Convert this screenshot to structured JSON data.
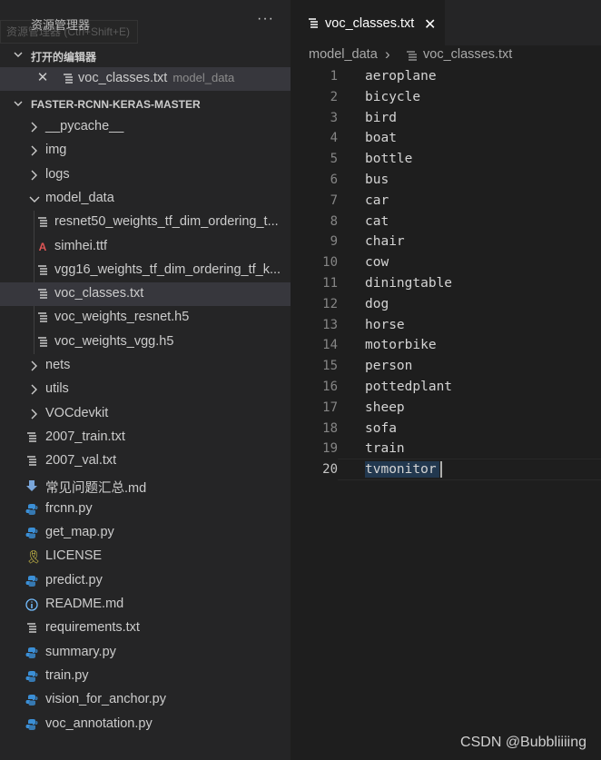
{
  "explorer": {
    "title": "资源管理器",
    "more": "···",
    "tooltip": "资源管理器 (Ctrl+Shift+E)"
  },
  "open_editors": {
    "header": "打开的编辑器",
    "items": [
      {
        "name": "voc_classes.txt",
        "folder": "model_data",
        "close": "✕"
      }
    ]
  },
  "project": {
    "header": "FASTER-RCNN-KERAS-MASTER",
    "tree": [
      {
        "label": "__pycache__",
        "type": "folder"
      },
      {
        "label": "img",
        "type": "folder"
      },
      {
        "label": "logs",
        "type": "folder"
      },
      {
        "label": "model_data",
        "type": "folder-open"
      },
      {
        "label": "resnet50_weights_tf_dim_ordering_t...",
        "type": "file-lines"
      },
      {
        "label": "simhei.ttf",
        "type": "font"
      },
      {
        "label": "vgg16_weights_tf_dim_ordering_tf_k...",
        "type": "file-lines"
      },
      {
        "label": "voc_classes.txt",
        "type": "file-lines"
      },
      {
        "label": "voc_weights_resnet.h5",
        "type": "file-lines"
      },
      {
        "label": "voc_weights_vgg.h5",
        "type": "file-lines"
      },
      {
        "label": "nets",
        "type": "folder"
      },
      {
        "label": "utils",
        "type": "folder"
      },
      {
        "label": "VOCdevkit",
        "type": "folder"
      },
      {
        "label": "2007_train.txt",
        "type": "file-lines"
      },
      {
        "label": "2007_val.txt",
        "type": "file-lines"
      },
      {
        "label": "常见问题汇总.md",
        "type": "download"
      },
      {
        "label": "frcnn.py",
        "type": "python"
      },
      {
        "label": "get_map.py",
        "type": "python"
      },
      {
        "label": "LICENSE",
        "type": "license"
      },
      {
        "label": "predict.py",
        "type": "python"
      },
      {
        "label": "README.md",
        "type": "info"
      },
      {
        "label": "requirements.txt",
        "type": "file-lines"
      },
      {
        "label": "summary.py",
        "type": "python"
      },
      {
        "label": "train.py",
        "type": "python"
      },
      {
        "label": "vision_for_anchor.py",
        "type": "python"
      },
      {
        "label": "voc_annotation.py",
        "type": "python"
      }
    ]
  },
  "editor": {
    "tab": {
      "label": "voc_classes.txt",
      "close": "✕"
    },
    "breadcrumb": {
      "folder": "model_data",
      "sep": "›",
      "file": "voc_classes.txt"
    },
    "lines": [
      "aeroplane",
      "bicycle",
      "bird",
      "boat",
      "bottle",
      "bus",
      "car",
      "cat",
      "chair",
      "cow",
      "diningtable",
      "dog",
      "horse",
      "motorbike",
      "person",
      "pottedplant",
      "sheep",
      "sofa",
      "train",
      "tvmonitor"
    ],
    "current_line": 20
  },
  "watermark": "CSDN @Bubbliiiing",
  "colors": {
    "python": "#3b8fd6",
    "font": "#e05555",
    "license": "#d4c44a",
    "info": "#75beff",
    "download": "#7aa6da"
  }
}
